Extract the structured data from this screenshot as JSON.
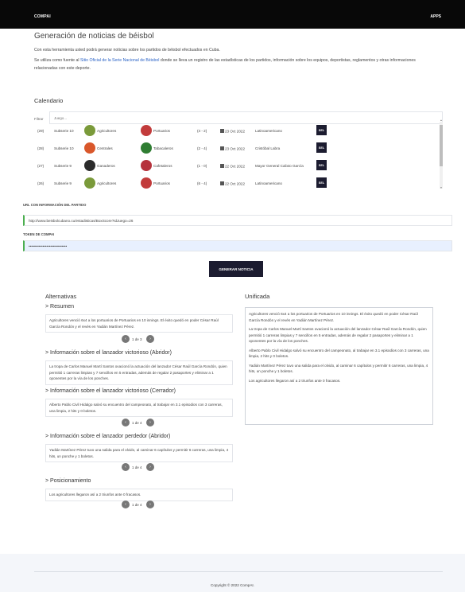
{
  "navbar": {
    "brand": "COMPAI",
    "apps": "APPS"
  },
  "page": {
    "title": "Generación de noticias de béisbol",
    "intro1": "Con esta herramienta usted podrá generar noticias sobre los partidos de béisbol efectuados en Cuba.",
    "intro2_before": "Se utiliza como fuente al ",
    "intro2_link": "Sitio Oficial de la Serie Nacional de Béisbol",
    "intro2_after": " donde se lleva un registro de las estadísticas de los partidos, información sobre los equipos, deportistas, reglamentos y otras informaciones relacionadas con este deporte."
  },
  "calendar": {
    "title": "Calendario",
    "filter_label": "Filtrar",
    "filter_placeholder": "Juego...",
    "sel_label": "SEL",
    "games": [
      {
        "num": "(29)",
        "subserie": "Subserie 10",
        "home": "Agricultores",
        "away": "Portuarios",
        "score": "(4 - 2)",
        "date": "23 Oct 2022",
        "venue": "Latinoamericano"
      },
      {
        "num": "(28)",
        "subserie": "Subserie 10",
        "home": "Centrales",
        "away": "Tabacaleros",
        "score": "(2 - 4)",
        "date": "23 Oct 2022",
        "venue": "Cristóbal Labra"
      },
      {
        "num": "(27)",
        "subserie": "Subserie 9",
        "home": "Ganaderos",
        "away": "Cafetaleros",
        "score": "(1 - 0)",
        "date": "22 Oct 2022",
        "venue": "Mayor General Calixto García"
      },
      {
        "num": "(26)",
        "subserie": "Subserie 9",
        "home": "Agricultores",
        "away": "Portuarios",
        "score": "(6 - 4)",
        "date": "22 Oct 2022",
        "venue": "Latinoamericano"
      }
    ],
    "team_colors": {
      "Agricultores": "#7a9a3a",
      "Portuarios": "#c23b3b",
      "Centrales": "#d9572b",
      "Tabacaleros": "#2f7d32",
      "Ganaderos": "#2b2b2b",
      "Cafetaleros": "#b5323c"
    }
  },
  "form": {
    "url_label": "URL CON INFORMACIÓN DEL PARTIDO",
    "url_value": "http://www.beisbolcubano.cu/estadisticas/BoxScore?IdJuego=26",
    "token_label": "TOKEN DE COMPAI",
    "token_value": "••••••••••••••••••••••••••••••",
    "generate_button": "GENERAR NOTICIA"
  },
  "alternatives": {
    "title": "Alternativas",
    "sections": [
      {
        "heading": "> Resumen",
        "text": "Agricultores venció 6x4 a los portuarios de Portuarios en 10 innings. El éxito quedó en poder César Raúl García Rondón y el revés en Yadián Martínez Pérez.",
        "pager": "1 de 3"
      },
      {
        "heading": "> Información sobre el lanzador victorioso (Abridor)",
        "text": "La tropa de Carlos Manuel Martí Santos ovacionó la actuación del lanzador César Raúl García Rondón, quien permitió 1 carreras limpias y 7 sencillos en 5 entradas, además de regalar 2 pasaportes y eliminar a 1 oponentes por la vía de los ponches.",
        "pager": ""
      },
      {
        "heading": "> Información sobre el lanzador victorioso (Cerrador)",
        "text": "Alberto Pablo Civil Hidalgo salvó su encuentro del campeonato, al trabajar en 3.1 episodios con 3 carreras, una limpia, 2 hits y 0 boletos.",
        "pager": "1 de 4"
      },
      {
        "heading": "> Información sobre el lanzador perdedor (Abridor)",
        "text": "Yadián Martínez Pérez tuvo una salida para el olvido, al caminar 6 capítulos y permitir 6 carreras, una limpia, 4 hits, un ponche y 1 boletos.",
        "pager": "1 de 4"
      },
      {
        "heading": "> Posicionamiento",
        "text": "Los agricultores llegaron así a 2 triunfos ante 0 fracasos.",
        "pager": "1 de 4"
      }
    ]
  },
  "unified": {
    "title": "Unificada",
    "paragraphs": [
      "Agricultores venció 6x4 a los portuarios de Portuarios en 10 innings. El éxito quedó en poder César Raúl García Rondón y el revés en Yadián Martínez Pérez.",
      "La tropa de Carlos Manuel Martí Santos ovacionó la actuación del lanzador César Raúl García Rondón, quien permitió 1 carreras limpias y 7 sencillos en 5 entradas, además de regalar 2 pasaportes y eliminar a 1 oponentes por la vía de los ponches.",
      "Alberto Pablo Civil Hidalgo salvó su encuentro del campeonato, al trabajar en 3.1 episodios con 3 carreras, una limpia, 2 hits y 0 boletos.",
      "Yadián Martínez Pérez tuvo una salida para el olvido, al caminar 6 capítulos y permitir 6 carreras, una limpia, 4 hits, un ponche y 1 boletos.",
      "Los agricultores llegaron así a 2 triunfos ante 0 fracasos."
    ]
  },
  "footer": {
    "copyright": "Copyright © 2022 CompAI."
  }
}
